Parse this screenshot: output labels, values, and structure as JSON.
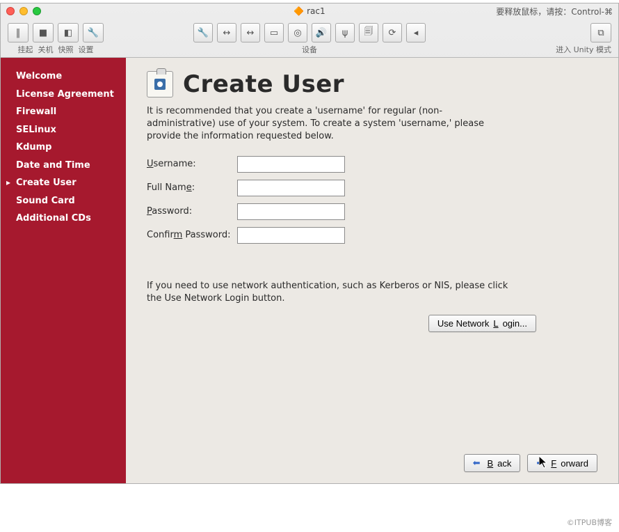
{
  "window": {
    "title": "rac1",
    "mouse_hint": "要释放鼠标，请按：Control-⌘"
  },
  "host_toolbar": {
    "left": [
      {
        "icon": "‖",
        "label": "挂起"
      },
      {
        "icon": "■",
        "label": "关机"
      },
      {
        "icon": "◧",
        "label": "快照"
      },
      {
        "icon": "🔧",
        "label": "设置"
      }
    ],
    "center_label": "设备",
    "center_icons": [
      "🔧",
      "↔",
      "↔",
      "▭",
      "◎",
      "🔊",
      "ψ",
      "🗐",
      "⟳",
      "◂"
    ],
    "right": {
      "icon": "⧉",
      "label": "进入 Unity 模式"
    }
  },
  "sidebar": {
    "items": [
      {
        "label": "Welcome"
      },
      {
        "label": "License Agreement"
      },
      {
        "label": "Firewall"
      },
      {
        "label": "SELinux"
      },
      {
        "label": "Kdump"
      },
      {
        "label": "Date and Time"
      },
      {
        "label": "Create User",
        "current": true
      },
      {
        "label": "Sound Card"
      },
      {
        "label": "Additional CDs"
      }
    ]
  },
  "main": {
    "title": "Create User",
    "description": "It is recommended that you create a 'username' for regular (non-administrative) use of your system. To create a system 'username,' please provide the information requested below.",
    "fields": {
      "username_label": "Username:",
      "fullname_label": "Full Name:",
      "password_label": "Password:",
      "confirm_label": "Confirm Password:",
      "username": "",
      "fullname": "",
      "password": "",
      "confirm": ""
    },
    "network_text": "If you need to use network authentication, such as Kerberos or NIS, please click the Use Network Login button.",
    "network_button": "Use Network Login...",
    "back_label": "Back",
    "forward_label": "orward"
  },
  "watermark": "©ITPUB博客"
}
